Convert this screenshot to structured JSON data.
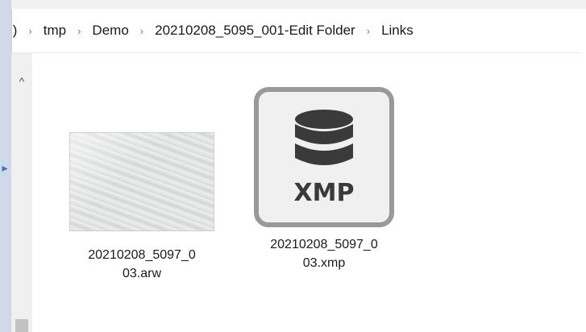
{
  "breadcrumb": {
    "items": [
      {
        "label": ":)"
      },
      {
        "label": "tmp"
      },
      {
        "label": "Demo"
      },
      {
        "label": "20210208_5095_001-Edit Folder"
      },
      {
        "label": "Links"
      }
    ],
    "separator": "›"
  },
  "scroll": {
    "up_glyph": "^"
  },
  "left_panel": {
    "arrow_glyph": "▸",
    "arrow_color": "#3b6fd1"
  },
  "files": [
    {
      "name_line1": "20210208_5097_0",
      "name_line2": "03.arw",
      "type": "raw-photo"
    },
    {
      "name_line1": "20210208_5097_0",
      "name_line2": "03.xmp",
      "type": "xmp-sidecar",
      "icon_label": "XMP",
      "icon": "database-icon"
    }
  ],
  "colors": {
    "icon_border": "#999999",
    "icon_fill": "#f0f0f0",
    "icon_glyph": "#3a3a3a"
  }
}
